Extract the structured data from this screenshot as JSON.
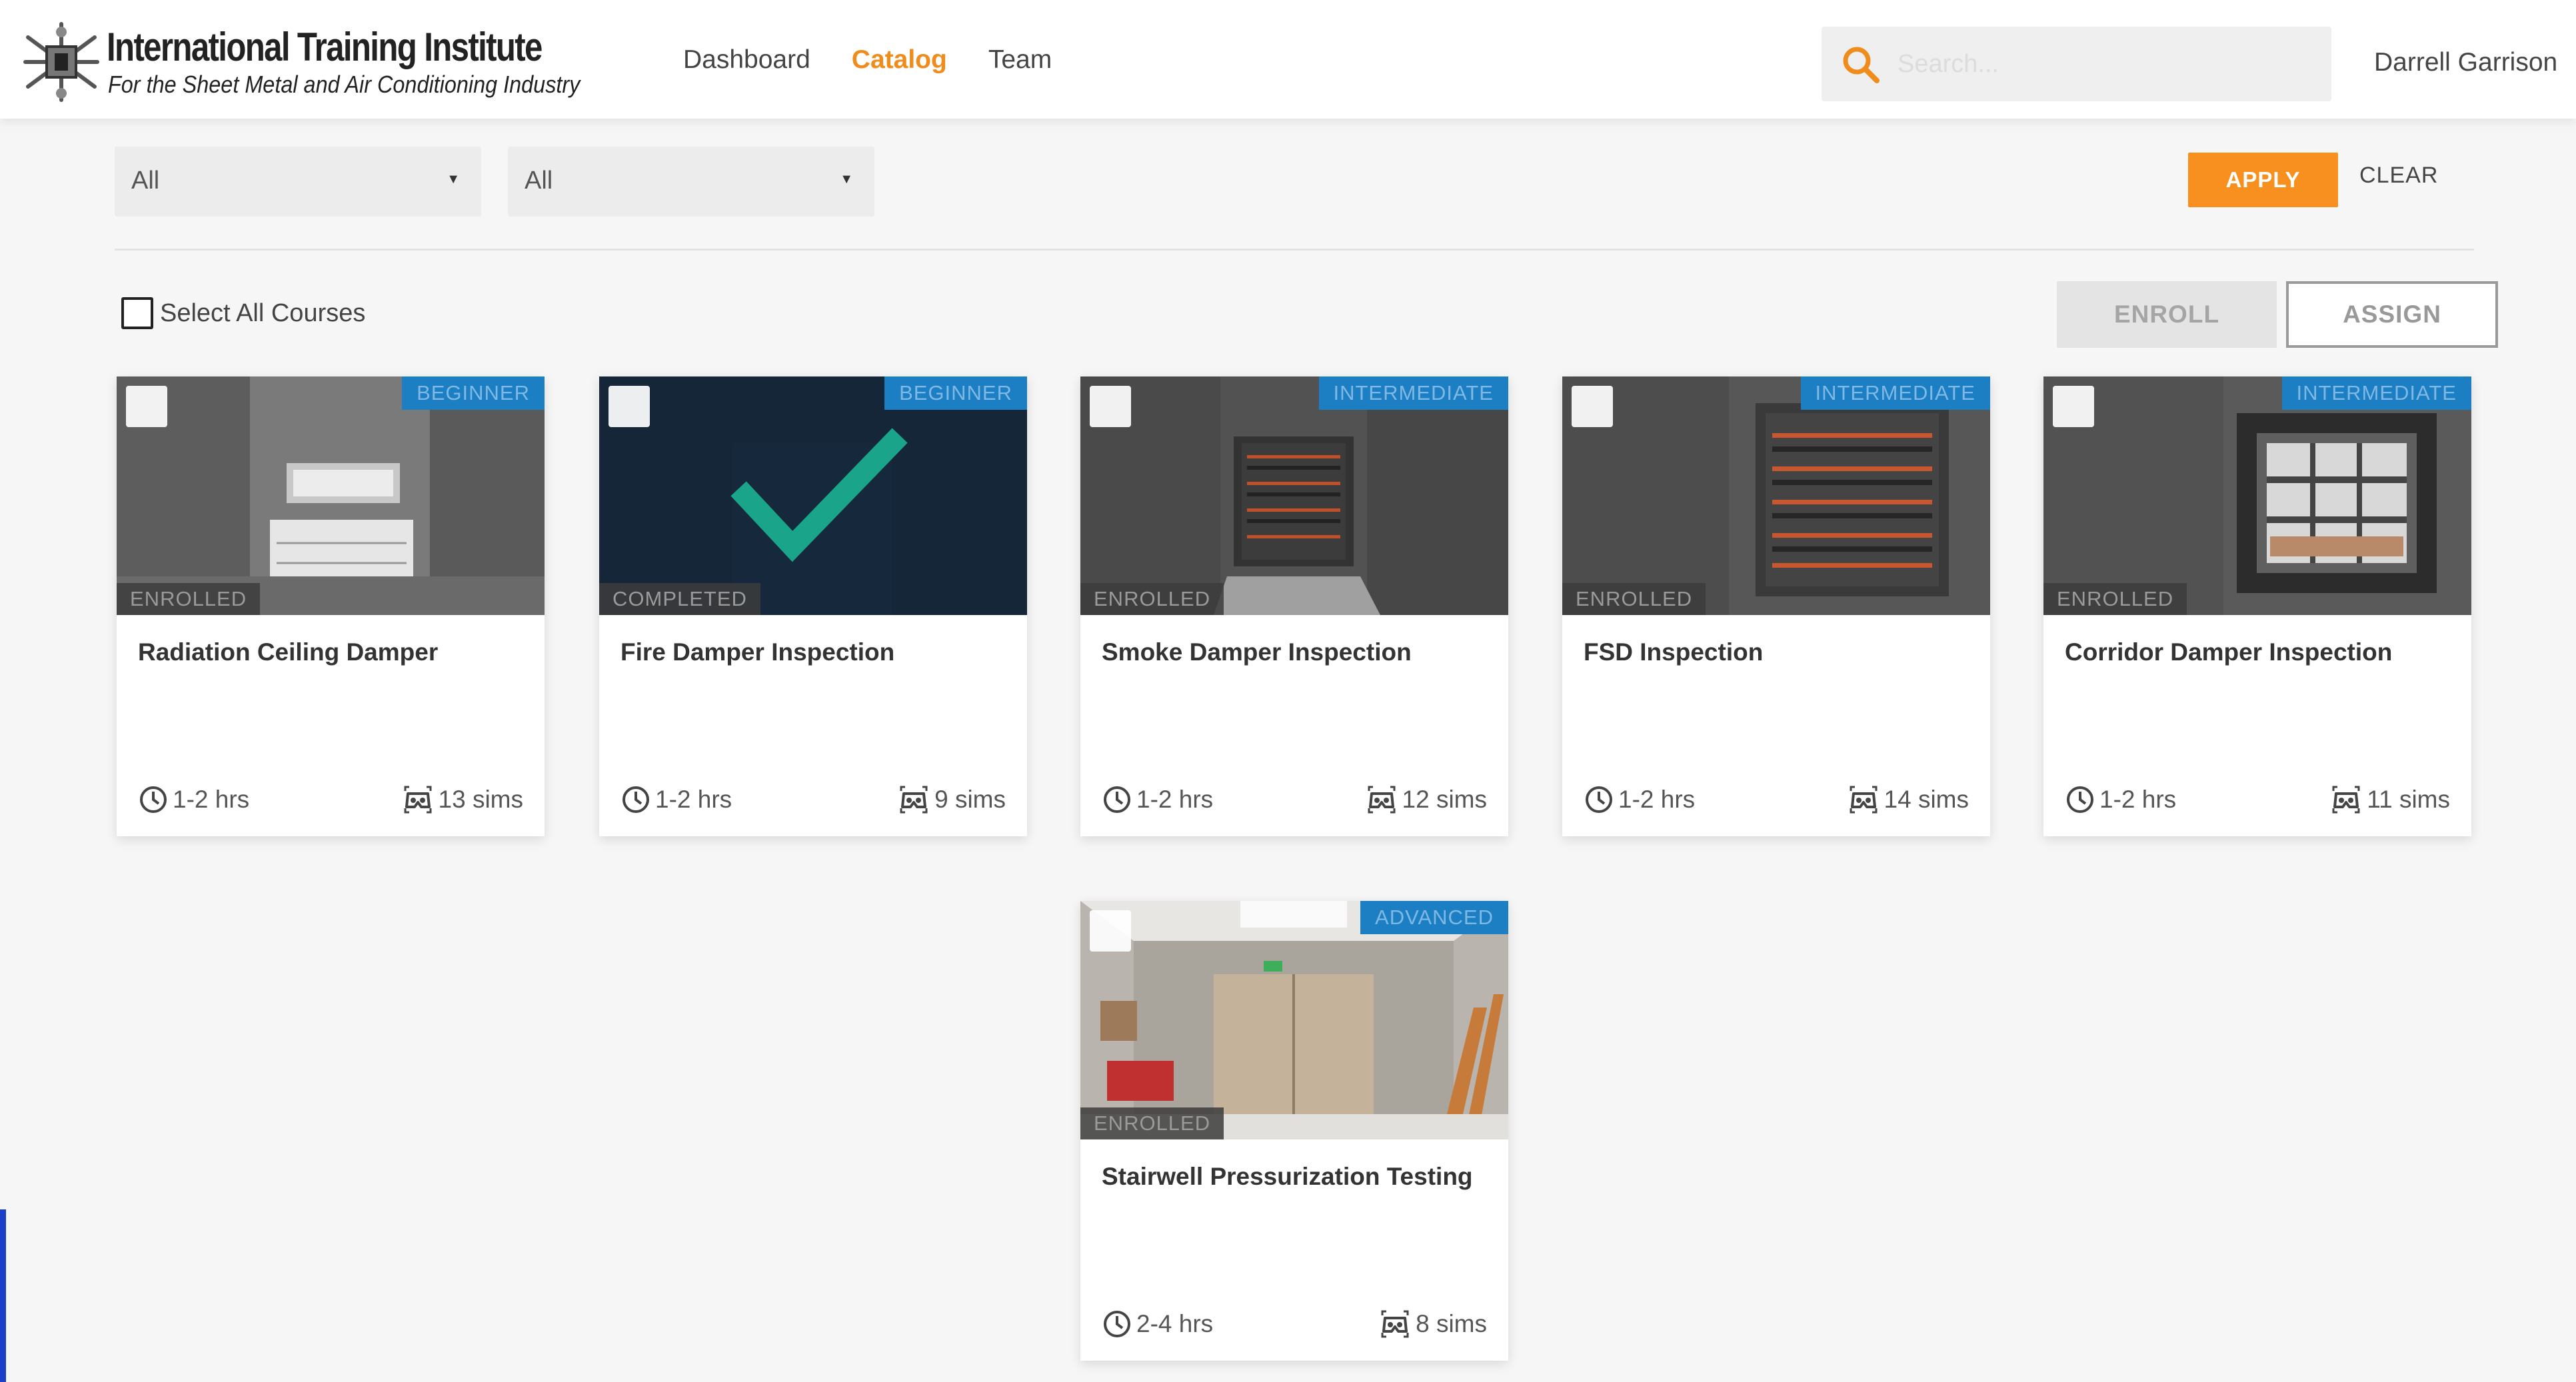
{
  "header": {
    "logo": {
      "title": "International Training Institute",
      "subtitle": "For the Sheet Metal and Air Conditioning Industry"
    },
    "nav": [
      {
        "label": "Dashboard",
        "active": false
      },
      {
        "label": "Catalog",
        "active": true
      },
      {
        "label": "Team",
        "active": false
      }
    ],
    "search": {
      "placeholder": "Search..."
    },
    "user_name": "Darrell Garrison"
  },
  "filters": {
    "select1": {
      "value": "All"
    },
    "select2": {
      "value": "All"
    },
    "apply_label": "APPLY",
    "clear_label": "CLEAR"
  },
  "actions": {
    "select_all_label": "Select All Courses",
    "enroll_label": "ENROLL",
    "assign_label": "ASSIGN"
  },
  "courses": [
    {
      "title": "Radiation Ceiling Damper",
      "level": "BEGINNER",
      "status": "ENROLLED",
      "duration": "1-2 hrs",
      "sims": "13 sims"
    },
    {
      "title": "Fire Damper Inspection",
      "level": "BEGINNER",
      "status": "COMPLETED",
      "duration": "1-2 hrs",
      "sims": "9 sims"
    },
    {
      "title": "Smoke Damper Inspection",
      "level": "INTERMEDIATE",
      "status": "ENROLLED",
      "duration": "1-2 hrs",
      "sims": "12 sims"
    },
    {
      "title": "FSD Inspection",
      "level": "INTERMEDIATE",
      "status": "ENROLLED",
      "duration": "1-2 hrs",
      "sims": "14 sims"
    },
    {
      "title": "Corridor Damper Inspection",
      "level": "INTERMEDIATE",
      "status": "ENROLLED",
      "duration": "1-2 hrs",
      "sims": "11 sims"
    },
    {
      "title": "Stairwell Pressurization Testing",
      "level": "ADVANCED",
      "status": "ENROLLED",
      "duration": "2-4 hrs",
      "sims": "8 sims"
    }
  ],
  "colors": {
    "accent": "#f7901e",
    "level_badge": "#1c7fc4",
    "completed_check": "#1aa58a"
  },
  "icons": {
    "search": "search-icon",
    "duration": "clock-icon",
    "sims": "vr-headset-icon",
    "completed": "checkmark-icon"
  }
}
